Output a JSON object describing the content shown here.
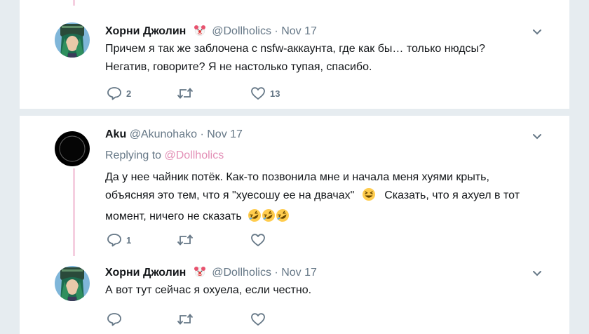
{
  "tweets": [
    {
      "name": "Хорни Джолин",
      "handle": "@Dollholics",
      "dot": "·",
      "date": "Nov 17",
      "text_lines": [
        "Причем я так же заблочена с nsfw-аккаунта, где как бы… только нюдсы?",
        "Негатив, говорите? Я не настолько тупая, спасибо."
      ],
      "replies": "2",
      "retweets": "",
      "likes": "13"
    },
    {
      "name": "Aku",
      "handle": "@Akunohako",
      "dot": "·",
      "date": "Nov 17",
      "replying_label": "Replying to",
      "replying_handle": "@Dollholics",
      "text_lines": [
        "Да у нее чайник потёк. Как-то позвонила мне и начала меня хуями крыть,",
        "объясняя это тем, что я \"хуесошу ее на двачах\"",
        "Сказать, что я ахуел в тот",
        "момент, ничего не сказать"
      ],
      "replies": "1",
      "retweets": "",
      "likes": ""
    },
    {
      "name": "Хорни Джолин",
      "handle": "@Dollholics",
      "dot": "·",
      "date": "Nov 17",
      "text_lines": [
        "А вот тут сейчас я охуела, если честно."
      ],
      "replies": "",
      "retweets": "",
      "likes": ""
    }
  ],
  "icons": {
    "reply": "reply-icon",
    "retweet": "retweet-icon",
    "like": "heart-icon",
    "more": "chevron-down-icon",
    "badge": "clown-face-emoji",
    "laughing": "grinning-squinting-face-emoji",
    "rofl": "rolling-on-floor-laughing-emoji"
  },
  "colors": {
    "background": "#e6ecf0",
    "thread_line": "#f5cfe0",
    "link_pink": "#e38fb6",
    "muted": "#657786"
  }
}
